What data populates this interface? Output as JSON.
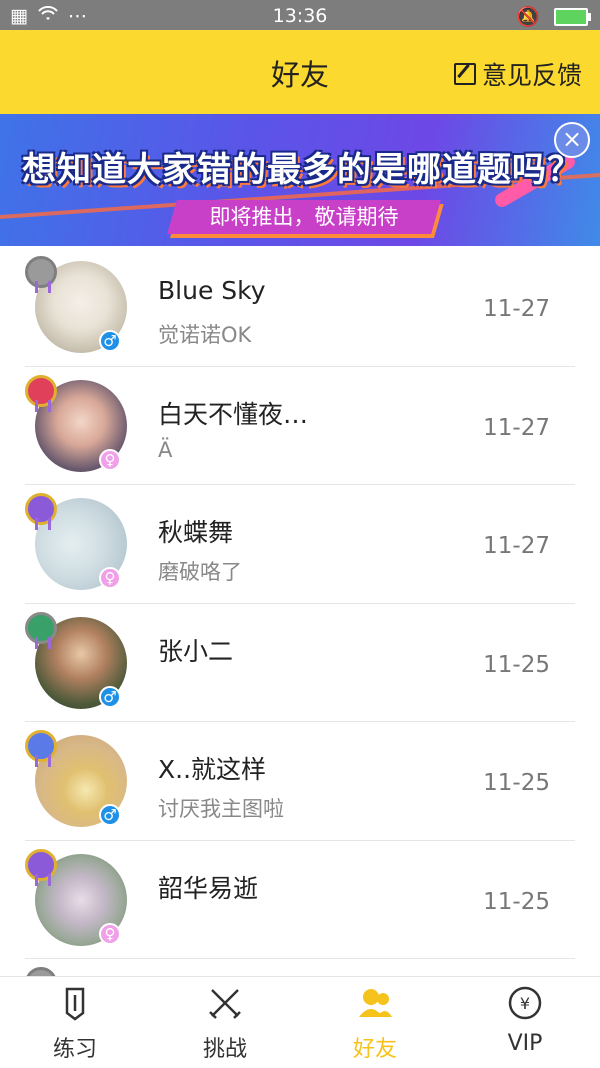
{
  "status_bar": {
    "time": "13:36",
    "left_icons": [
      "sim-icon",
      "wifi-icon",
      "more-dots-icon"
    ],
    "right_icons": [
      "mute-icon",
      "battery-icon"
    ]
  },
  "header": {
    "title": "好友",
    "feedback_label": "意见反馈"
  },
  "banner": {
    "headline": "想知道大家错的最多的是哪道题吗？",
    "subtext": "即将推出，敬请期待",
    "close_symbol": "×"
  },
  "friends": [
    {
      "name": "Blue Sky",
      "message": "觉诺诺OK",
      "date": "11-27",
      "gender": "male"
    },
    {
      "name": "白天不懂夜…",
      "message": "Ä",
      "date": "11-27",
      "gender": "female"
    },
    {
      "name": "秋蝶舞",
      "message": "磨破咯了",
      "date": "11-27",
      "gender": "female"
    },
    {
      "name": "张小二",
      "message": "",
      "date": "11-25",
      "gender": "male"
    },
    {
      "name": "X..就这样",
      "message": "讨厌我主图啦",
      "date": "11-25",
      "gender": "male"
    },
    {
      "name": "韶华易逝",
      "message": "",
      "date": "11-25",
      "gender": "female"
    }
  ],
  "tabs": [
    {
      "label": "练习",
      "icon": "pencil-icon"
    },
    {
      "label": "挑战",
      "icon": "crossed-swords-icon"
    },
    {
      "label": "好友",
      "icon": "friends-icon",
      "active": true
    },
    {
      "label": "VIP",
      "icon": "yuan-coin-icon"
    }
  ],
  "colors": {
    "accent": "#fcd92f",
    "active_tab": "#f6c21c",
    "male": "#1e90e8",
    "female": "#f0a0e8"
  }
}
